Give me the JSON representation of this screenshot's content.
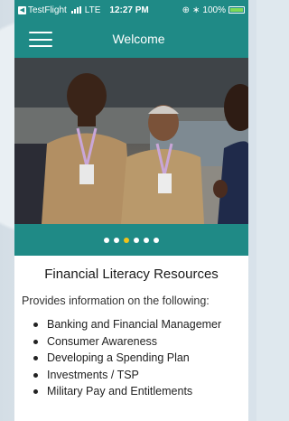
{
  "status_bar": {
    "carrier": "TestFlight",
    "network": "LTE",
    "time": "12:27 PM",
    "battery": "100%",
    "battery_level": 1.0
  },
  "nav": {
    "title": "Welcome"
  },
  "carousel": {
    "slide_count": 6,
    "active_index": 2
  },
  "content": {
    "title": "Financial Literacy Resources",
    "intro": "Provides information on the following:",
    "topics": [
      "Banking and Financial Managemer",
      "Consumer Awareness",
      "Developing a Spending Plan",
      "Investments / TSP",
      "Military Pay and Entitlements"
    ]
  },
  "colors": {
    "theme": "#1f8a86",
    "active_dot": "#f2c21b",
    "inactive_dot": "#ffffff"
  },
  "icons": [
    "back-icon",
    "signal-icon",
    "location-icon",
    "bluetooth-icon",
    "battery-icon",
    "hamburger-icon"
  ]
}
